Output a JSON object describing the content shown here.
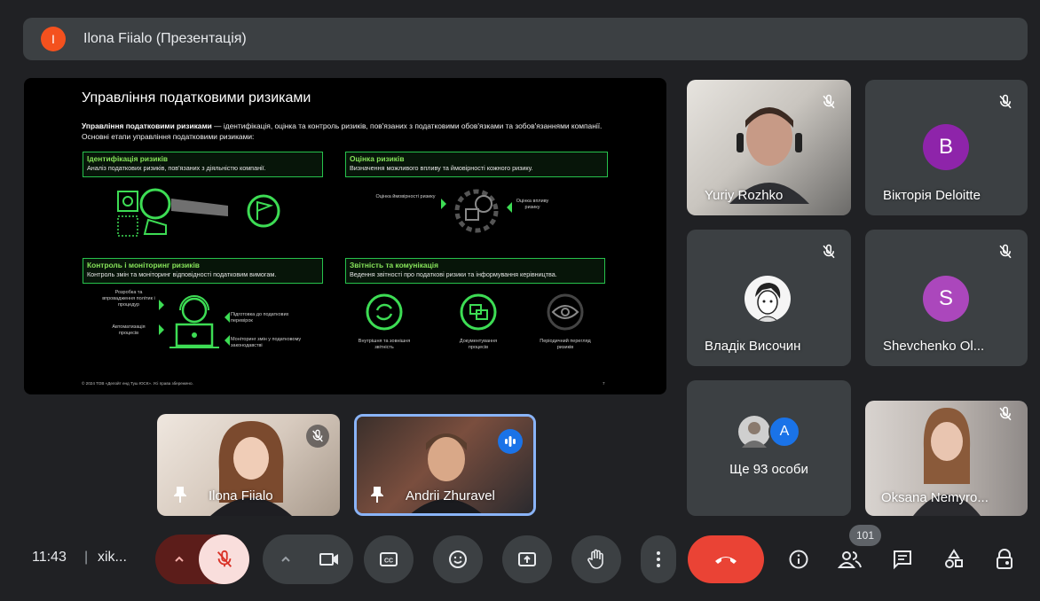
{
  "presenter": {
    "avatar_letter": "I",
    "title": "Ilona Fiialo (Презентація)"
  },
  "slide": {
    "title": "Управління податковими ризиками",
    "intro_bold": "Управління податковими ризиками",
    "intro_rest": " — ідентифікація, оцінка та контроль ризиків, пов'язаних з податковими обов'язками та зобов'язаннями компанії. Основні етапи управління податковими ризиками:",
    "sections": [
      {
        "title": "Ідентифікація ризиків",
        "desc": "Аналіз податкових ризиків, пов'язаних з діяльністю компанії."
      },
      {
        "title": "Оцінка ризиків",
        "desc": "Визначення можливого впливу та ймовірності кожного ризику."
      },
      {
        "title": "Контроль і моніторинг ризиків",
        "desc": "Контроль змін та моніторинг відповідності податковим вимогам."
      },
      {
        "title": "Звітність та комунікація",
        "desc": "Ведення звітності про податкові ризики та інформування керівництва."
      }
    ],
    "captions": {
      "probability": "Оцінка ймовірності ризику",
      "impact": "Оцінка впливу ризику",
      "policy": "Розробка та впровадження політик і процедур",
      "automation": "Автоматизація процесів",
      "prep": "Підготовка до податкових перевірок",
      "monitoring": "Моніторинг змін у податковому законодавстві",
      "reporting": "Внутрішня та зовнішня звітність",
      "documenting": "Документування процесів",
      "review": "Періодичний перегляд ризиків"
    },
    "footer": "© 2024 ТОВ «Делойт енд Туш ЮСК». Усі права збережено.",
    "page": "7"
  },
  "tiles": {
    "yuriy": {
      "name": "Yuriy Rozhko"
    },
    "viktoria": {
      "name": "Вікторія Deloitte",
      "avatar_letter": "B",
      "avatar_color": "#8e24aa"
    },
    "vladik": {
      "name": "Владік Височин"
    },
    "shevchenko": {
      "name": "Shevchenko Ol...",
      "avatar_letter": "S",
      "avatar_color": "#ab47bc"
    },
    "others": {
      "label": "Ще 93 особи",
      "avatar_letter": "A",
      "avatar_color": "#1a73e8"
    },
    "oksana": {
      "name": "Oksana Nemyro..."
    },
    "ilona": {
      "name": "Ilona Fiialo"
    },
    "andrii": {
      "name": "Andrii Zhuravel"
    }
  },
  "toolbar": {
    "time": "11:43",
    "separator": "|",
    "meeting_code": "xik...",
    "participants_count": "101"
  },
  "colors": {
    "background": "#202124",
    "tile": "#3c4043",
    "mic_off_bg": "#f9dedc",
    "mic_off_icon": "#d93025",
    "end_call": "#ea4335",
    "speaking": "#1a73e8",
    "slide_accent": "#27c24c"
  }
}
